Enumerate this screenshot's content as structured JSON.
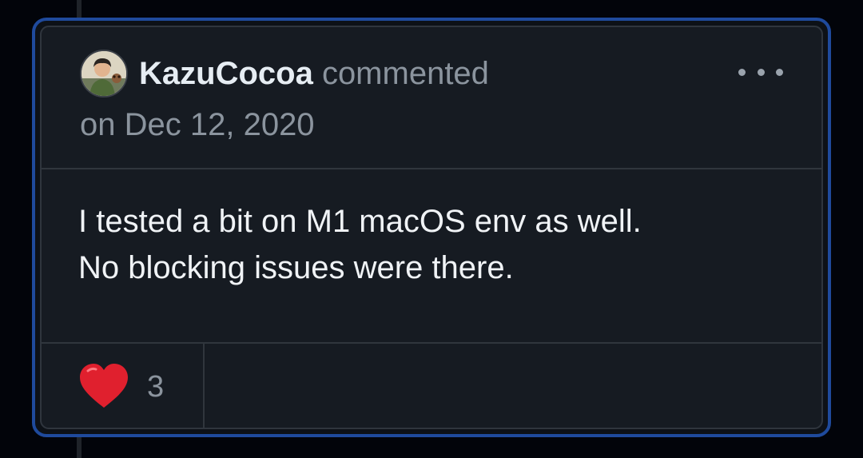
{
  "comment": {
    "author": "KazuCocoa",
    "action": "commented",
    "timestamp": "on Dec 12, 2020",
    "body_lines": [
      "I tested a bit on M1 macOS env as well.",
      "No blocking issues were there."
    ],
    "reactions": [
      {
        "icon": "red-heart-emoji",
        "count": "3"
      }
    ]
  },
  "colors": {
    "highlight_border": "#1f4a9c",
    "card_background": "#161b22",
    "page_background": "#02040a",
    "primary_text": "#e6edf3",
    "muted_text": "#8b949e",
    "heart": "#e0202e"
  }
}
